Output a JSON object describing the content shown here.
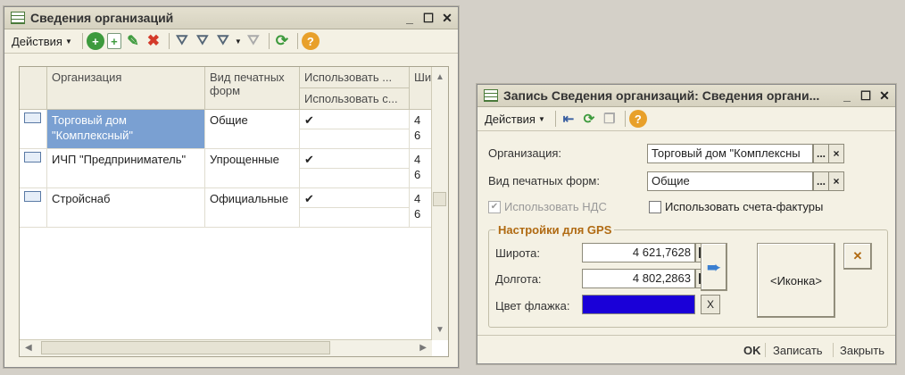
{
  "win1": {
    "title": "Сведения организаций",
    "menu_actions": "Действия",
    "columns": {
      "org": "Организация",
      "print_type": "Вид печатных форм",
      "use_a": "Использовать ...",
      "use_b": "Использовать с...",
      "lat_short": "Ши"
    },
    "rows": [
      {
        "org": "Торговый дом \"Комплексный\"",
        "print_type": "Общие",
        "check": "✔",
        "lat": "4 6"
      },
      {
        "org": "ИЧП \"Предприниматель\"",
        "print_type": "Упрощенные",
        "check": "✔",
        "lat": "4 6"
      },
      {
        "org": "Стройснаб",
        "print_type": "Официальные",
        "check": "✔",
        "lat": "4 6"
      }
    ]
  },
  "win2": {
    "title": "Запись Сведения организаций: Сведения органи...",
    "menu_actions": "Действия",
    "org_label": "Организация:",
    "org_value": "Торговый дом \"Комплексны",
    "print_label": "Вид печатных форм:",
    "print_value": "Общие",
    "nds_label": "Использовать НДС",
    "invoice_label": "Использовать счета-фактуры",
    "gps_group": "Настройки для GPS",
    "lat_label": "Широта:",
    "lat_value": "4 621,7628",
    "lon_label": "Долгота:",
    "lon_value": "4 802,2863",
    "flag_label": "Цвет флажка:",
    "flag_color": "#1a00d8",
    "icon_button": "<Иконка>",
    "clear_x": "X",
    "ok": "OK",
    "save": "Записать",
    "close": "Закрыть"
  },
  "icons": {
    "ellipsis": "...",
    "close_x": "×"
  }
}
